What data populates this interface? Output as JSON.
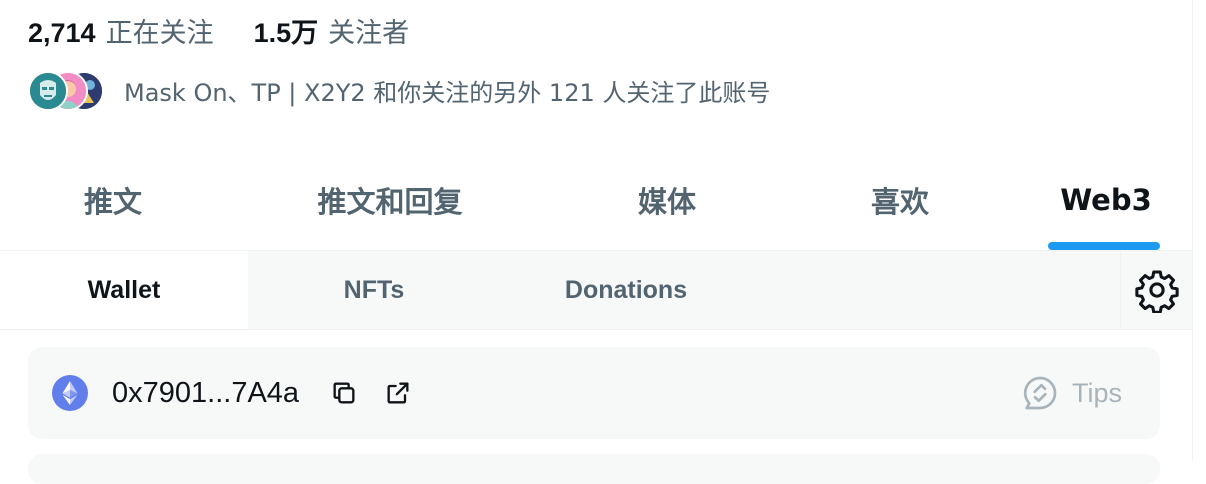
{
  "stats": {
    "following_count": "2,714",
    "following_label": "正在关注",
    "followers_count": "1.5万",
    "followers_label": "关注者"
  },
  "followed_by": {
    "text": "Mask On、TP | X2Y2 和你关注的另外 121 人关注了此账号"
  },
  "main_tabs": [
    {
      "label": "推文",
      "active": false
    },
    {
      "label": "推文和回复",
      "active": false
    },
    {
      "label": "媒体",
      "active": false
    },
    {
      "label": "喜欢",
      "active": false
    },
    {
      "label": "Web3",
      "active": true
    }
  ],
  "sub_tabs": [
    {
      "label": "Wallet",
      "active": true
    },
    {
      "label": "NFTs",
      "active": false
    },
    {
      "label": "Donations",
      "active": false
    }
  ],
  "settings": {
    "icon": "gear-icon"
  },
  "wallet": {
    "chain_icon": "ethereum-icon",
    "address": "0x7901...7A4a",
    "tips_label": "Tips"
  },
  "colors": {
    "accent": "#1d9bf0",
    "text_primary": "#0f1419",
    "text_secondary": "#536471",
    "muted": "#a8b3ba",
    "surface": "#f7f9f9",
    "eth": "#627eea"
  }
}
